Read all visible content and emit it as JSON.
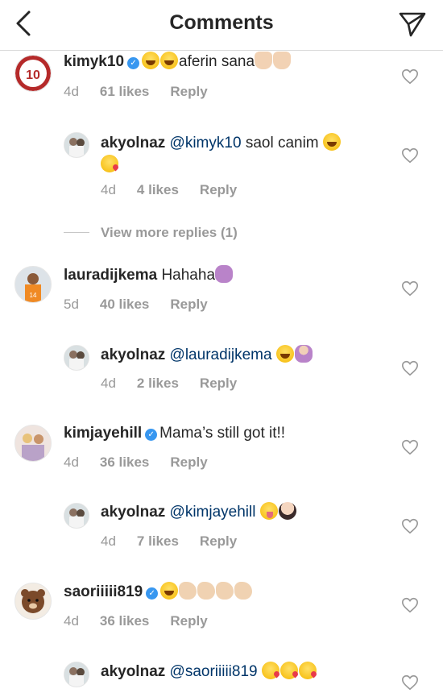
{
  "header": {
    "title": "Comments"
  },
  "comments": [
    {
      "user": "kimyk10",
      "verified": true,
      "mention": "",
      "text": "aferin sana",
      "time": "4d",
      "likes": "61 likes",
      "reply": "Reply"
    },
    {
      "user": "akyolnaz",
      "verified": false,
      "mention": "@kimyk10",
      "text": "saol canim",
      "time": "4d",
      "likes": "4 likes",
      "reply": "Reply"
    },
    {
      "user": "lauradijkema",
      "verified": false,
      "mention": "",
      "text": "Hahaha",
      "time": "5d",
      "likes": "40 likes",
      "reply": "Reply"
    },
    {
      "user": "akyolnaz",
      "verified": false,
      "mention": "@lauradijkema",
      "text": "",
      "time": "4d",
      "likes": "2 likes",
      "reply": "Reply"
    },
    {
      "user": "kimjayehill",
      "verified": true,
      "mention": "",
      "text": "Mama’s still got it!!",
      "time": "4d",
      "likes": "36 likes",
      "reply": "Reply"
    },
    {
      "user": "akyolnaz",
      "verified": false,
      "mention": "@kimjayehill",
      "text": "",
      "time": "4d",
      "likes": "7 likes",
      "reply": "Reply"
    },
    {
      "user": "saoriiiii819",
      "verified": true,
      "mention": "",
      "text": "",
      "time": "4d",
      "likes": "36 likes",
      "reply": "Reply"
    },
    {
      "user": "akyolnaz",
      "verified": false,
      "mention": "@saoriiiii819",
      "text": ""
    }
  ],
  "view_more": "View more replies (1)",
  "colors": {
    "verified": "#3897f0",
    "mention": "#003569",
    "meta": "#999999"
  }
}
